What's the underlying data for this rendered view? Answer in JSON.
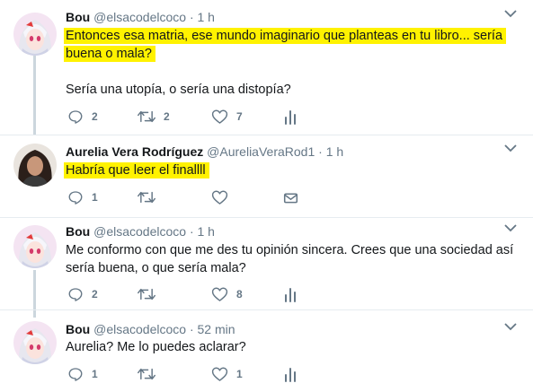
{
  "colors": {
    "highlight": "#fff200",
    "secondary_text": "#657786",
    "thread_line": "#ccd6dd",
    "divider": "#e6ecf0"
  },
  "tweets": [
    {
      "name": "Bou",
      "handle": "@elsacodelcoco",
      "separator": "·",
      "time": "1 h",
      "avatar": "anime-girl-avatar",
      "text_lines": [
        "Entonces esa matria, ese mundo imaginario que planteas en tu libro... sería",
        "buena o mala?",
        "",
        "Sería una utopía, o sería una distopía?"
      ],
      "highlighted_lines": [
        0,
        1
      ],
      "actions": {
        "reply": "2",
        "retweet": "2",
        "like": "7",
        "extra_icon": "analytics-icon"
      }
    },
    {
      "name": "Aurelia Vera Rodríguez",
      "handle": "@AureliaVeraRod1",
      "separator": "·",
      "time": "1 h",
      "avatar": "woman-photo-avatar",
      "text_lines": [
        "Habría que leer el finallll"
      ],
      "highlighted_lines": [
        0
      ],
      "actions": {
        "reply": "1",
        "retweet": "",
        "like": "",
        "extra_icon": "direct-message-icon"
      }
    },
    {
      "name": "Bou",
      "handle": "@elsacodelcoco",
      "separator": "·",
      "time": "1 h",
      "avatar": "anime-girl-avatar",
      "text_lines": [
        "Me conformo con que me des tu opinión sincera. Crees que una sociedad así",
        "sería buena, o que sería mala?"
      ],
      "highlighted_lines": [],
      "actions": {
        "reply": "2",
        "retweet": "",
        "like": "8",
        "extra_icon": "analytics-icon"
      }
    },
    {
      "name": "Bou",
      "handle": "@elsacodelcoco",
      "separator": "·",
      "time": "52 min",
      "avatar": "anime-girl-avatar",
      "text_lines": [
        "Aurelia? Me lo puedes aclarar?"
      ],
      "highlighted_lines": [],
      "actions": {
        "reply": "1",
        "retweet": "",
        "like": "1",
        "extra_icon": "analytics-icon"
      }
    }
  ]
}
